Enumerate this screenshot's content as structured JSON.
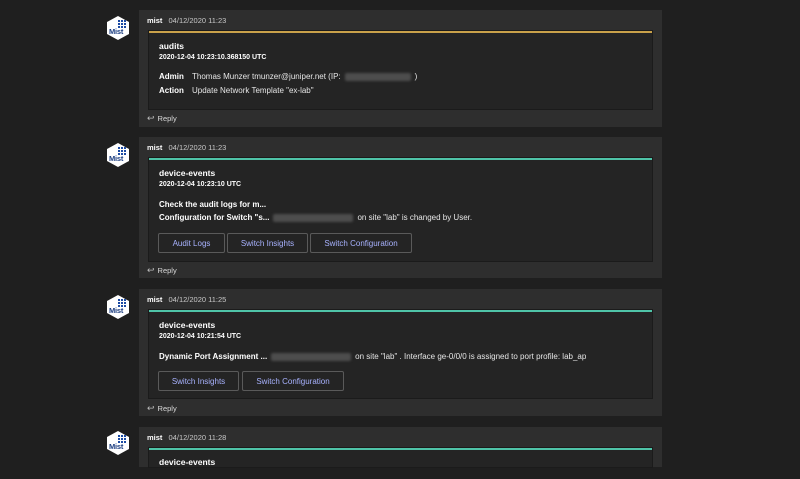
{
  "messages": [
    {
      "author": "mist",
      "timestamp": "04/12/2020 11:23",
      "accent_color": "#c9a14a",
      "card": {
        "title": "audits",
        "datetime": "2020-12-04 10:23:10.368150 UTC",
        "facts": [
          {
            "key": "Admin",
            "value_prefix": "Thomas Munzer tmunzer@juniper.net (IP:",
            "value_suffix": ")"
          },
          {
            "key": "Action",
            "value": "Update Network Template \"ex-lab\""
          }
        ]
      },
      "reply_label": "Reply"
    },
    {
      "author": "mist",
      "timestamp": "04/12/2020 11:23",
      "accent_color": "#4fc4a8",
      "card": {
        "title": "device-events",
        "datetime": "2020-12-04 10:23:10 UTC",
        "heading": "Check the audit logs for m...",
        "line_bold": "Configuration for Switch \"s...",
        "line_rest": "on site \"lab\" is changed by User.",
        "buttons": [
          "Audit Logs",
          "Switch Insights",
          "Switch Configuration"
        ]
      },
      "reply_label": "Reply"
    },
    {
      "author": "mist",
      "timestamp": "04/12/2020 11:25",
      "accent_color": "#4fc4a8",
      "card": {
        "title": "device-events",
        "datetime": "2020-12-04 10:21:54 UTC",
        "line_bold": "Dynamic Port Assignment ...",
        "line_rest": "on site \"lab\" . Interface ge-0/0/0 is assigned to port profile: lab_ap",
        "buttons": [
          "Switch Insights",
          "Switch Configuration"
        ]
      },
      "reply_label": "Reply"
    },
    {
      "author": "mist",
      "timestamp": "04/12/2020 11:28",
      "accent_color": "#4fc4a8",
      "card": {
        "title": "device-events"
      }
    }
  ],
  "avatar_text": "Mist",
  "icons": {
    "avatar": "mist-logo-icon",
    "reply": "reply-arrow-icon"
  }
}
